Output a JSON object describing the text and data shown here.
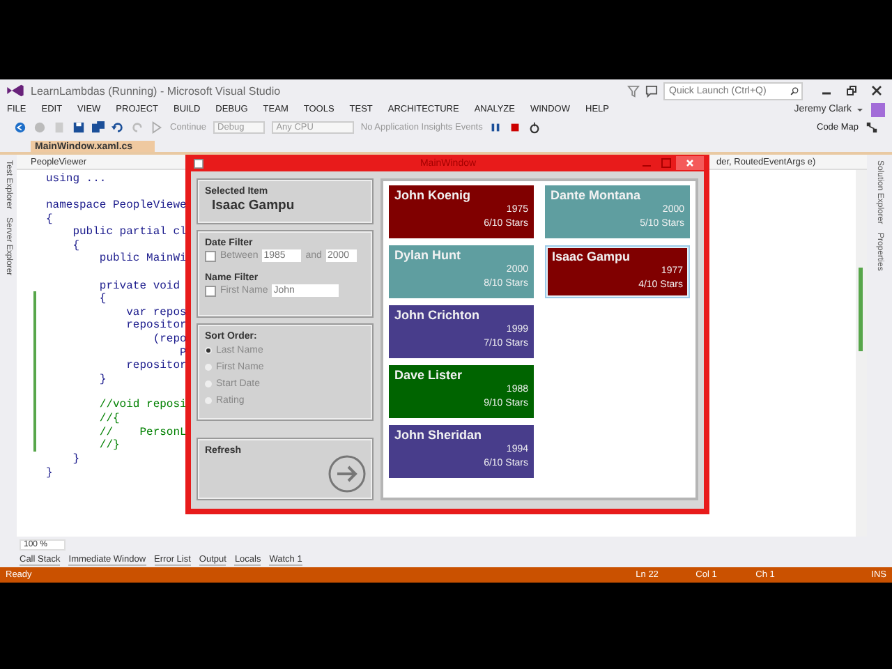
{
  "window": {
    "title": "LearnLambdas (Running) - Microsoft Visual Studio"
  },
  "quick_launch": {
    "placeholder": "Quick Launch (Ctrl+Q)"
  },
  "menu": [
    "FILE",
    "EDIT",
    "VIEW",
    "PROJECT",
    "BUILD",
    "DEBUG",
    "TEAM",
    "TOOLS",
    "TEST",
    "ARCHITECTURE",
    "ANALYZE",
    "WINDOW",
    "HELP"
  ],
  "user": "Jeremy Clark",
  "toolbar": {
    "continue": "Continue",
    "configuration": "Debug",
    "platform": "Any CPU",
    "insights": "No Application Insights Events",
    "code_map": "Code Map"
  },
  "document_tab": {
    "title": "MainWindow.xaml.cs"
  },
  "left_tool_tabs": [
    "Test Explorer",
    "Server Explorer"
  ],
  "right_tool_tabs": [
    "Solution Explorer",
    "Properties"
  ],
  "nav_bar": {
    "type": "PeopleViewer",
    "member": "der, RoutedEventArgs e)"
  },
  "code_lines": [
    {
      "kind": "code",
      "text": "using ...",
      "changed": false
    },
    {
      "kind": "blank",
      "changed": false
    },
    {
      "kind": "code",
      "text": "namespace PeopleViewe",
      "changed": false
    },
    {
      "kind": "code",
      "text": "{",
      "changed": false
    },
    {
      "kind": "code",
      "text": "    public partial cl",
      "changed": false
    },
    {
      "kind": "code",
      "text": "    {",
      "changed": false
    },
    {
      "kind": "code",
      "text": "        public MainWi",
      "changed": false
    },
    {
      "kind": "blank",
      "changed": false
    },
    {
      "kind": "code",
      "text": "        private void",
      "changed": false
    },
    {
      "kind": "code",
      "text": "        {",
      "changed": true
    },
    {
      "kind": "code",
      "text": "            var repos",
      "changed": true
    },
    {
      "kind": "code",
      "text": "            repositor",
      "changed": true
    },
    {
      "kind": "code",
      "text": "                (repo",
      "changed": true
    },
    {
      "kind": "code",
      "text": "                    P",
      "changed": true
    },
    {
      "kind": "code",
      "text": "            repositor",
      "changed": true
    },
    {
      "kind": "code",
      "text": "        }",
      "changed": true
    },
    {
      "kind": "blank",
      "changed": true
    },
    {
      "kind": "comment",
      "text": "        //void reposi",
      "changed": true
    },
    {
      "kind": "comment",
      "text": "        //{",
      "changed": true
    },
    {
      "kind": "comment",
      "text": "        //    PersonL",
      "changed": true
    },
    {
      "kind": "comment",
      "text": "        //}",
      "changed": true
    },
    {
      "kind": "code",
      "text": "    }",
      "changed": false
    },
    {
      "kind": "code",
      "text": "}",
      "changed": false
    }
  ],
  "zoom": "100 %",
  "bottom_tabs": [
    "Call Stack",
    "Immediate Window",
    "Error List",
    "Output",
    "Locals",
    "Watch 1"
  ],
  "status_bar": {
    "state": "Ready",
    "line": "Ln 22",
    "column": "Col 1",
    "char": "Ch 1",
    "mode": "INS"
  },
  "app_window": {
    "title": "MainWindow",
    "selected_item": {
      "label": "Selected Item",
      "value": "Isaac Gampu"
    },
    "date_filter": {
      "label": "Date Filter",
      "checked": false,
      "between": "Between",
      "from": "1985",
      "and": "and",
      "to": "2000"
    },
    "name_filter": {
      "label": "Name Filter",
      "checked": false,
      "field_label": "First Name",
      "value": "John"
    },
    "sort_order": {
      "label": "Sort Order:",
      "options": [
        {
          "label": "Last Name",
          "selected": true
        },
        {
          "label": "First Name",
          "selected": false
        },
        {
          "label": "Start Date",
          "selected": false
        },
        {
          "label": "Rating",
          "selected": false
        }
      ]
    },
    "refresh": {
      "label": "Refresh"
    },
    "people_columns": [
      [
        {
          "name": "John Koenig",
          "year": "1975",
          "rating": "6/10 Stars",
          "color": "#800000",
          "selected": false
        },
        {
          "name": "Dylan Hunt",
          "year": "2000",
          "rating": "8/10 Stars",
          "color": "#5f9ea0",
          "selected": false
        },
        {
          "name": "John Crichton",
          "year": "1999",
          "rating": "7/10 Stars",
          "color": "#483d8b",
          "selected": false
        },
        {
          "name": "Dave Lister",
          "year": "1988",
          "rating": "9/10 Stars",
          "color": "#006400",
          "selected": false
        },
        {
          "name": "John Sheridan",
          "year": "1994",
          "rating": "6/10 Stars",
          "color": "#483d8b",
          "selected": false
        }
      ],
      [
        {
          "name": "Dante Montana",
          "year": "2000",
          "rating": "5/10 Stars",
          "color": "#5f9ea0",
          "selected": false
        },
        {
          "name": "Isaac Gampu",
          "year": "1977",
          "rating": "4/10 Stars",
          "color": "#800000",
          "selected": true
        }
      ]
    ]
  }
}
